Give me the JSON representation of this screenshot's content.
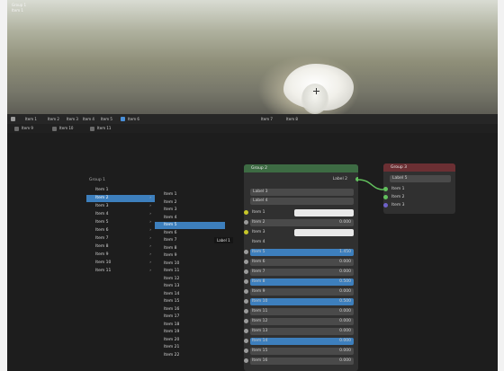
{
  "viewport": {
    "overlay_lines": [
      "Group 1",
      "Item 1"
    ]
  },
  "toolbar": {
    "items": [
      "Item 1",
      "Item 2",
      "Item 3",
      "Item 4",
      "Item 5",
      "Item 6"
    ],
    "center": [
      "Item 7",
      "Item 8"
    ],
    "row2": [
      "Item 9",
      "Item 10",
      "Item 11"
    ]
  },
  "menu1": {
    "header": "Group 1",
    "items": [
      {
        "label": "Item 1",
        "submenu": false,
        "highlighted": false
      },
      {
        "label": "Item 2",
        "submenu": true,
        "highlighted": true
      },
      {
        "label": "Item 3",
        "submenu": true,
        "highlighted": false
      },
      {
        "label": "Item 4",
        "submenu": true,
        "highlighted": false
      },
      {
        "label": "Item 5",
        "submenu": true,
        "highlighted": false
      },
      {
        "label": "Item 6",
        "submenu": true,
        "highlighted": false
      },
      {
        "label": "Item 7",
        "submenu": true,
        "highlighted": false
      },
      {
        "label": "Item 8",
        "submenu": true,
        "highlighted": false
      },
      {
        "label": "Item 9",
        "submenu": true,
        "highlighted": false
      },
      {
        "label": "Item 10",
        "submenu": true,
        "highlighted": false
      },
      {
        "label": "Item 11",
        "submenu": true,
        "highlighted": false
      }
    ]
  },
  "menu2": {
    "items": [
      {
        "label": "Item 1",
        "highlighted": false
      },
      {
        "label": "Item 2",
        "highlighted": false
      },
      {
        "label": "Item 3",
        "highlighted": false
      },
      {
        "label": "Item 4",
        "highlighted": false
      },
      {
        "label": "Item 5",
        "highlighted": true
      },
      {
        "label": "Item 6",
        "highlighted": false
      },
      {
        "label": "Item 7",
        "highlighted": false
      },
      {
        "label": "Item 8",
        "highlighted": false
      },
      {
        "label": "Item 9",
        "highlighted": false
      },
      {
        "label": "Item 10",
        "highlighted": false
      },
      {
        "label": "Item 11",
        "highlighted": false
      },
      {
        "label": "Item 12",
        "highlighted": false
      },
      {
        "label": "Item 13",
        "highlighted": false
      },
      {
        "label": "Item 14",
        "highlighted": false
      },
      {
        "label": "Item 15",
        "highlighted": false
      },
      {
        "label": "Item 16",
        "highlighted": false
      },
      {
        "label": "Item 17",
        "highlighted": false
      },
      {
        "label": "Item 18",
        "highlighted": false
      },
      {
        "label": "Item 19",
        "highlighted": false
      },
      {
        "label": "Item 20",
        "highlighted": false
      },
      {
        "label": "Item 21",
        "highlighted": false
      },
      {
        "label": "Item 22",
        "highlighted": false
      }
    ]
  },
  "tooltip": "Label 1",
  "node_bsdf": {
    "title": "Group 2",
    "output_label": "Label 2",
    "dropdown1": "Label 3",
    "dropdown2": "Label 4",
    "rows": [
      {
        "label": "Item 1",
        "value": "",
        "kind": "white",
        "socket": "y"
      },
      {
        "label": "Item 2",
        "value": "0.000",
        "kind": "gray",
        "socket": "gray"
      },
      {
        "label": "Item 3",
        "value": "",
        "kind": "white",
        "socket": "y"
      },
      {
        "label": "Item 4",
        "value": "",
        "kind": "header",
        "socket": ""
      },
      {
        "label": "Item 5",
        "value": "1.450",
        "kind": "blue",
        "socket": "gray"
      },
      {
        "label": "Item 6",
        "value": "0.000",
        "kind": "gray",
        "socket": "gray"
      },
      {
        "label": "Item 7",
        "value": "0.000",
        "kind": "gray",
        "socket": "gray"
      },
      {
        "label": "Item 8",
        "value": "0.500",
        "kind": "blue",
        "socket": "gray"
      },
      {
        "label": "Item 9",
        "value": "0.000",
        "kind": "gray",
        "socket": "gray"
      },
      {
        "label": "Item 10",
        "value": "0.500",
        "kind": "blue",
        "socket": "gray"
      },
      {
        "label": "Item 11",
        "value": "0.000",
        "kind": "gray",
        "socket": "gray"
      },
      {
        "label": "Item 12",
        "value": "0.000",
        "kind": "gray",
        "socket": "gray"
      },
      {
        "label": "Item 13",
        "value": "0.000",
        "kind": "gray",
        "socket": "gray"
      },
      {
        "label": "Item 14",
        "value": "0.000",
        "kind": "blue",
        "socket": "gray"
      },
      {
        "label": "Item 15",
        "value": "0.000",
        "kind": "gray",
        "socket": "gray"
      },
      {
        "label": "Item 16",
        "value": "0.000",
        "kind": "gray",
        "socket": "gray"
      }
    ]
  },
  "node_output": {
    "title": "Group 3",
    "dropdown": "Label 5",
    "inputs": [
      "Item 1",
      "Item 2",
      "Item 3"
    ]
  },
  "colors": {
    "accent": "#3d7fbd",
    "node_green": "#3d6b43",
    "node_red": "#6b2f33",
    "socket_green": "#62c05d",
    "socket_yellow": "#c7c729"
  }
}
